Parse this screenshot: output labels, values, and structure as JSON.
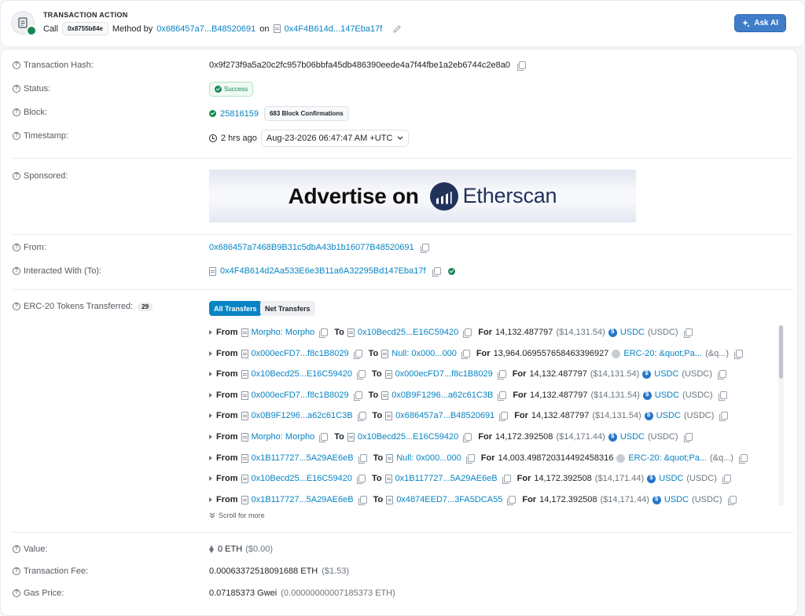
{
  "action": {
    "title": "TRANSACTION ACTION",
    "call_label": "Call",
    "method_code": "0x8755b84e",
    "method_by_label": "Method by",
    "from_address": "0x686457a7...B48520691",
    "on_label": "on",
    "contract_address": "0x4F4B614d...147Eba17f",
    "ask_ai_label": "Ask AI"
  },
  "details": {
    "tx_hash": {
      "label": "Transaction Hash:",
      "value": "0x9f273f9a5a20c2fc957b06bbfa45db486390eede4a7f44fbe1a2eb6744c2e8a0"
    },
    "status": {
      "label": "Status:",
      "value": "Success"
    },
    "block": {
      "label": "Block:",
      "value": "25816159",
      "confirmations": "683 Block Confirmations"
    },
    "timestamp": {
      "label": "Timestamp:",
      "ago": "2 hrs ago",
      "datetime": "Aug-23-2026 06:47:47 AM +UTC"
    },
    "sponsored": {
      "label": "Sponsored:",
      "ad_text": "Advertise on",
      "ad_brand": "Etherscan"
    },
    "from": {
      "label": "From:",
      "value": "0x686457a7468B9B31c5dbA43b1b16077B48520691"
    },
    "interacted": {
      "label": "Interacted With (To):",
      "value": "0x4F4B614d2Aa533E6e3B11a6A32295Bd147Eba17f"
    },
    "tokens": {
      "label": "ERC-20 Tokens Transferred:",
      "count": "29",
      "tab_all": "All Transfers",
      "tab_net": "Net Transfers",
      "scroll_more": "Scroll for more",
      "kw_from": "From",
      "kw_to": "To",
      "kw_for": "For",
      "rows": [
        {
          "from": "Morpho: Morpho",
          "to": "0x10Becd25...E16C59420",
          "amount": "14,132.487797",
          "usd": "($14,131.54)",
          "token": "USDC",
          "symbol": "(USDC)",
          "logo": "usdc"
        },
        {
          "from": "0x000ecFD7...f8c1B8029",
          "to": "Null: 0x000...000",
          "amount": "13,964.069557658463396927",
          "usd": "",
          "token": "ERC-20: &quot;Pa...",
          "symbol": "(&q...)",
          "logo": "grey"
        },
        {
          "from": "0x10Becd25...E16C59420",
          "to": "0x000ecFD7...f8c1B8029",
          "amount": "14,132.487797",
          "usd": "($14,131.54)",
          "token": "USDC",
          "symbol": "(USDC)",
          "logo": "usdc"
        },
        {
          "from": "0x000ecFD7...f8c1B8029",
          "to": "0x0B9F1296...a62c61C3B",
          "amount": "14,132.487797",
          "usd": "($14,131.54)",
          "token": "USDC",
          "symbol": "(USDC)",
          "logo": "usdc"
        },
        {
          "from": "0x0B9F1296...a62c61C3B",
          "to": "0x686457a7...B48520691",
          "amount": "14,132.487797",
          "usd": "($14,131.54)",
          "token": "USDC",
          "symbol": "(USDC)",
          "logo": "usdc"
        },
        {
          "from": "Morpho: Morpho",
          "to": "0x10Becd25...E16C59420",
          "amount": "14,172.392508",
          "usd": "($14,171.44)",
          "token": "USDC",
          "symbol": "(USDC)",
          "logo": "usdc"
        },
        {
          "from": "0x1B117727...5A29AE6eB",
          "to": "Null: 0x000...000",
          "amount": "14,003.498720314492458316",
          "usd": "",
          "token": "ERC-20: &quot;Pa...",
          "symbol": "(&q...)",
          "logo": "grey"
        },
        {
          "from": "0x10Becd25...E16C59420",
          "to": "0x1B117727...5A29AE6eB",
          "amount": "14,172.392508",
          "usd": "($14,171.44)",
          "token": "USDC",
          "symbol": "(USDC)",
          "logo": "usdc"
        },
        {
          "from": "0x1B117727...5A29AE6eB",
          "to": "0x4874EED7...3FA5DCA55",
          "amount": "14,172.392508",
          "usd": "($14,171.44)",
          "token": "USDC",
          "symbol": "(USDC)",
          "logo": "usdc"
        }
      ]
    },
    "value": {
      "label": "Value:",
      "value": "0 ETH",
      "usd": "($0.00)"
    },
    "fee": {
      "label": "Transaction Fee:",
      "value": "0.00063372518091688 ETH",
      "usd": "($1.53)"
    },
    "gas": {
      "label": "Gas Price:",
      "value": "0.07185373 Gwei",
      "eth": "(0.00000000007185373 ETH)"
    }
  },
  "colors": {
    "link": "#0784c3",
    "success": "#198754",
    "accent_button": "#3f7dc9"
  },
  "icons": [
    "document-icon",
    "code-badge-icon",
    "sparkle-icon",
    "edit-icon",
    "question-icon",
    "copy-icon",
    "check-circle-icon",
    "clock-icon",
    "chevron-down-icon",
    "caret-right-icon",
    "usdc-logo-icon",
    "eth-icon",
    "double-chevron-down-icon"
  ]
}
